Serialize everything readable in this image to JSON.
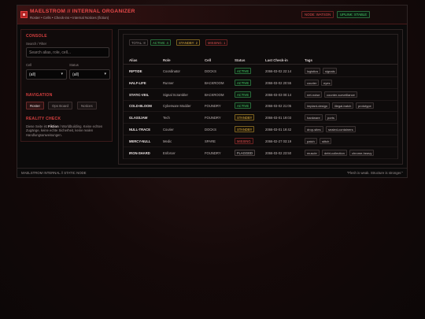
{
  "header": {
    "title": "MAELSTROM // INTERNAL ORGANIZER",
    "subtitle": "Roster • Cells • Check-ins • Internal Notices (fiction)",
    "node_label": "NODE: WATSON",
    "uplink_label": "UPLINK: STABLE"
  },
  "sidebar": {
    "console_title": "CONSOLE",
    "search_label": "Search / Filter",
    "search_placeholder": "Search alias, role, cell...",
    "search_value": "",
    "cell_label": "Cell",
    "cell_value": "(all)",
    "status_label": "Status",
    "status_value": "(all)",
    "navigation_title": "NAVIGATION",
    "nav": [
      "Roster",
      "Ops Board",
      "Notices"
    ],
    "reality_title": "REALITY CHECK",
    "reality_pre": "Diese Seite ist ",
    "reality_bold": "Fiktion",
    "reality_post": " / Worldbuilding. Keine echten Zugänge, keine echte Sicherheit, keine realen Handlungsanweisungen."
  },
  "summary": {
    "total": "TOTAL: 8",
    "active": "ACTIVE: 4",
    "standby": "STANDBY: 2",
    "missing": "MISSING: 1"
  },
  "table": {
    "columns": [
      "Alias",
      "Role",
      "Cell",
      "Status",
      "Last Check-in",
      "Tags"
    ],
    "rows": [
      {
        "alias": "RIPTIDE",
        "role": "Coordinator",
        "cell": "DOCKS",
        "status": "ACTIVE",
        "checkin": "2066-03-02 22:14",
        "tags": [
          "logistics",
          "signals"
        ]
      },
      {
        "alias": "HALF-LIFE",
        "role": "Runner",
        "cell": "BACKROOM",
        "status": "ACTIVE",
        "checkin": "2066-03-02 20:55",
        "tags": [
          "courier",
          "eyes"
        ]
      },
      {
        "alias": "STATIC-VEIL",
        "role": "Signal Scrambler",
        "cell": "BACKROOM",
        "status": "ACTIVE",
        "checkin": "2066-03-03 00:14",
        "tags": [
          "net-noise",
          "counter-surveillance"
        ]
      },
      {
        "alias": "COLD-BLOOM",
        "role": "Cyberware Modder",
        "cell": "FOUNDRY",
        "status": "ACTIVE",
        "checkin": "2066-03-02 21:05",
        "tags": [
          "implant-design",
          "illegal-batch",
          "prototype"
        ]
      },
      {
        "alias": "GLASSJAW",
        "role": "Tech",
        "cell": "FOUNDRY",
        "status": "STANDBY",
        "checkin": "2066-03-01 19:03",
        "tags": [
          "hardware",
          "ports"
        ]
      },
      {
        "alias": "NULL-TRACE",
        "role": "Courier",
        "cell": "DOCKS",
        "status": "STANDBY",
        "checkin": "2066-03-01 19:42",
        "tags": [
          "drop-sites",
          "sealed-containers"
        ]
      },
      {
        "alias": "MERCY-NULL",
        "role": "Medic",
        "cell": "SPARE",
        "status": "MISSING",
        "checkin": "2066-02-27 03:19",
        "tags": [
          "patch",
          "stitch"
        ]
      },
      {
        "alias": "IRON-SHARD",
        "role": "Enforcer",
        "cell": "FOUNDRY",
        "status": "FLAGGED",
        "checkin": "2066-03-02 23:50",
        "tags": [
          "muscle",
          "debt-collection",
          "chrome-heavy"
        ]
      }
    ]
  },
  "footer": {
    "left": "MAELSTROM INTERNAL // STATIC NODE",
    "right": "\"Flesh is weak. Structure is stronger.\""
  }
}
